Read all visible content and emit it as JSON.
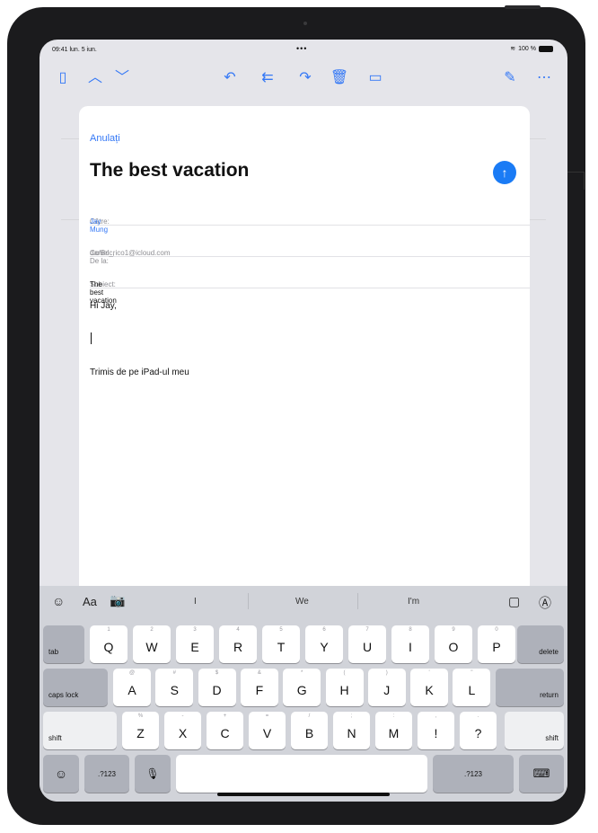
{
  "status": {
    "time": "09:41",
    "date": "lun. 5 iun.",
    "dots": "•••",
    "battery": "100 %",
    "wifi_icon": "wifi-icon",
    "battery_icon": "battery-icon"
  },
  "toolbar": {
    "icons": [
      "sidebar-icon",
      "chevron-up-icon",
      "chevron-down-icon",
      "reply-icon",
      "reply-all-icon",
      "forward-icon",
      "trash-icon",
      "folder-icon",
      "compose-icon",
      "more-icon"
    ],
    "glyphs": {
      "sidebar": "▯",
      "up": "︿",
      "down": "﹀",
      "reply": "↶",
      "reply_all": "⇇",
      "forward": "↷",
      "trash": "🗑",
      "folder": "▭",
      "compose": "✎",
      "more": "⋯"
    }
  },
  "compose": {
    "cancel": "Anulați",
    "title": "The best vacation",
    "send_glyph": "↑",
    "to_label": "Către:",
    "to_value": "Jay Mung",
    "cc_label": "Cc/Bcc, De la:",
    "cc_value": "daniel_rico1@icloud.com",
    "subject_label": "Subiect:",
    "subject_value": "The best vacation",
    "greeting": "Hi Jay,",
    "signature": "Trimis de pe iPad-ul meu"
  },
  "keyboard": {
    "suggestions": [
      "I",
      "We",
      "I'm"
    ],
    "left_icons": {
      "emoji_text": "☺",
      "format": "Aa",
      "camera": "📷"
    },
    "right_icons": {
      "document": "▢",
      "markup": "Ⓐ"
    },
    "row1": [
      {
        "k": "Q",
        "h": "1"
      },
      {
        "k": "W",
        "h": "2"
      },
      {
        "k": "E",
        "h": "3"
      },
      {
        "k": "R",
        "h": "4"
      },
      {
        "k": "T",
        "h": "5"
      },
      {
        "k": "Y",
        "h": "6"
      },
      {
        "k": "U",
        "h": "7"
      },
      {
        "k": "I",
        "h": "8"
      },
      {
        "k": "O",
        "h": "9"
      },
      {
        "k": "P",
        "h": "0"
      }
    ],
    "row2": [
      {
        "k": "A",
        "h": "@"
      },
      {
        "k": "S",
        "h": "#"
      },
      {
        "k": "D",
        "h": "$"
      },
      {
        "k": "F",
        "h": "&"
      },
      {
        "k": "G",
        "h": "*"
      },
      {
        "k": "H",
        "h": "("
      },
      {
        "k": "J",
        "h": ")"
      },
      {
        "k": "K",
        "h": "'"
      },
      {
        "k": "L",
        "h": "\""
      }
    ],
    "row3": [
      {
        "k": "Z",
        "h": "%"
      },
      {
        "k": "X",
        "h": "-"
      },
      {
        "k": "C",
        "h": "+"
      },
      {
        "k": "V",
        "h": "="
      },
      {
        "k": "B",
        "h": "/"
      },
      {
        "k": "N",
        "h": ";"
      },
      {
        "k": "M",
        "h": ":"
      },
      {
        "k": "!",
        "h": ","
      },
      {
        "k": "?",
        "h": "."
      }
    ],
    "tab": "tab",
    "delete": "delete",
    "caps": "caps lock",
    "return": "return",
    "shift": "shift",
    "num": ".?123",
    "emoji": "☺",
    "mic": "🎙",
    "hide": "⌨"
  }
}
